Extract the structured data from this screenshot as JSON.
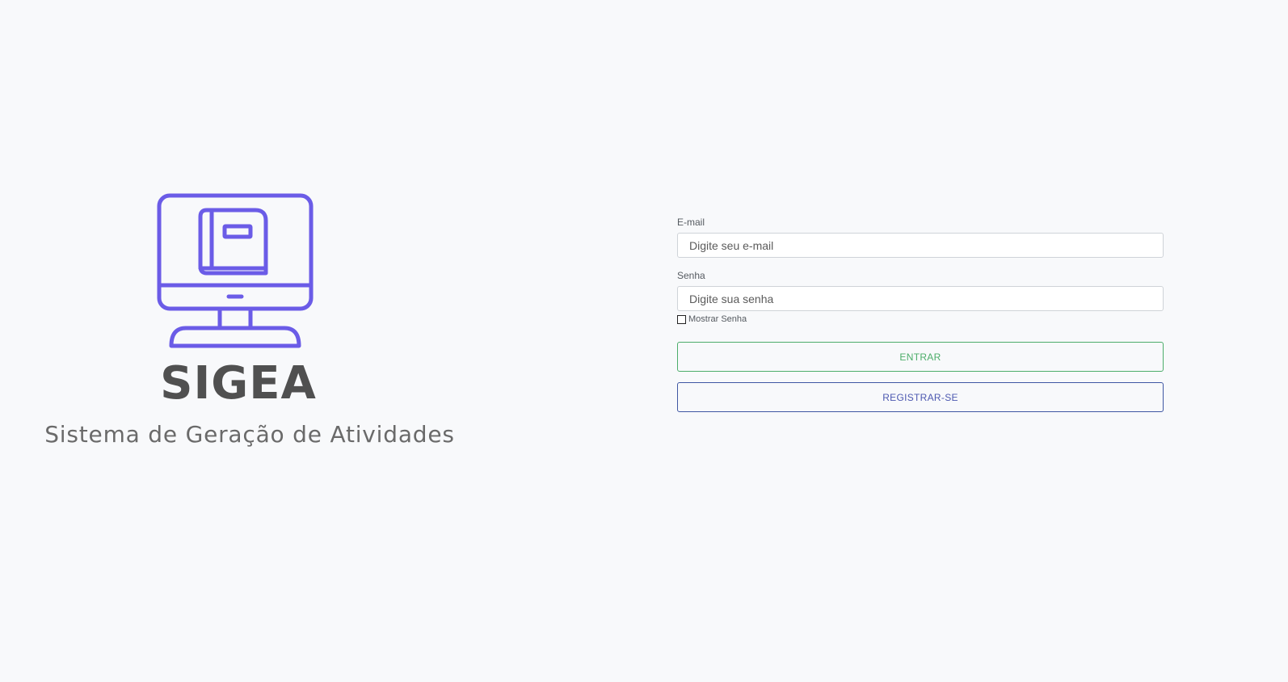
{
  "brand": {
    "name": "SIGEA",
    "tagline": "Sistema de Geração de Atividades",
    "icon": "monitor-book-icon",
    "accent_color": "#6b5ce7"
  },
  "login": {
    "email_label": "E-mail",
    "email_placeholder": "Digite seu e-mail",
    "email_value": "",
    "password_label": "Senha",
    "password_placeholder": "Digite sua senha",
    "password_value": "",
    "show_password_label": "Mostrar Senha",
    "show_password_checked": false,
    "enter_label": "ENTRAR",
    "enter_color": "#4cad6a",
    "register_label": "REGISTRAR-SE",
    "register_color": "#4c58b0"
  }
}
